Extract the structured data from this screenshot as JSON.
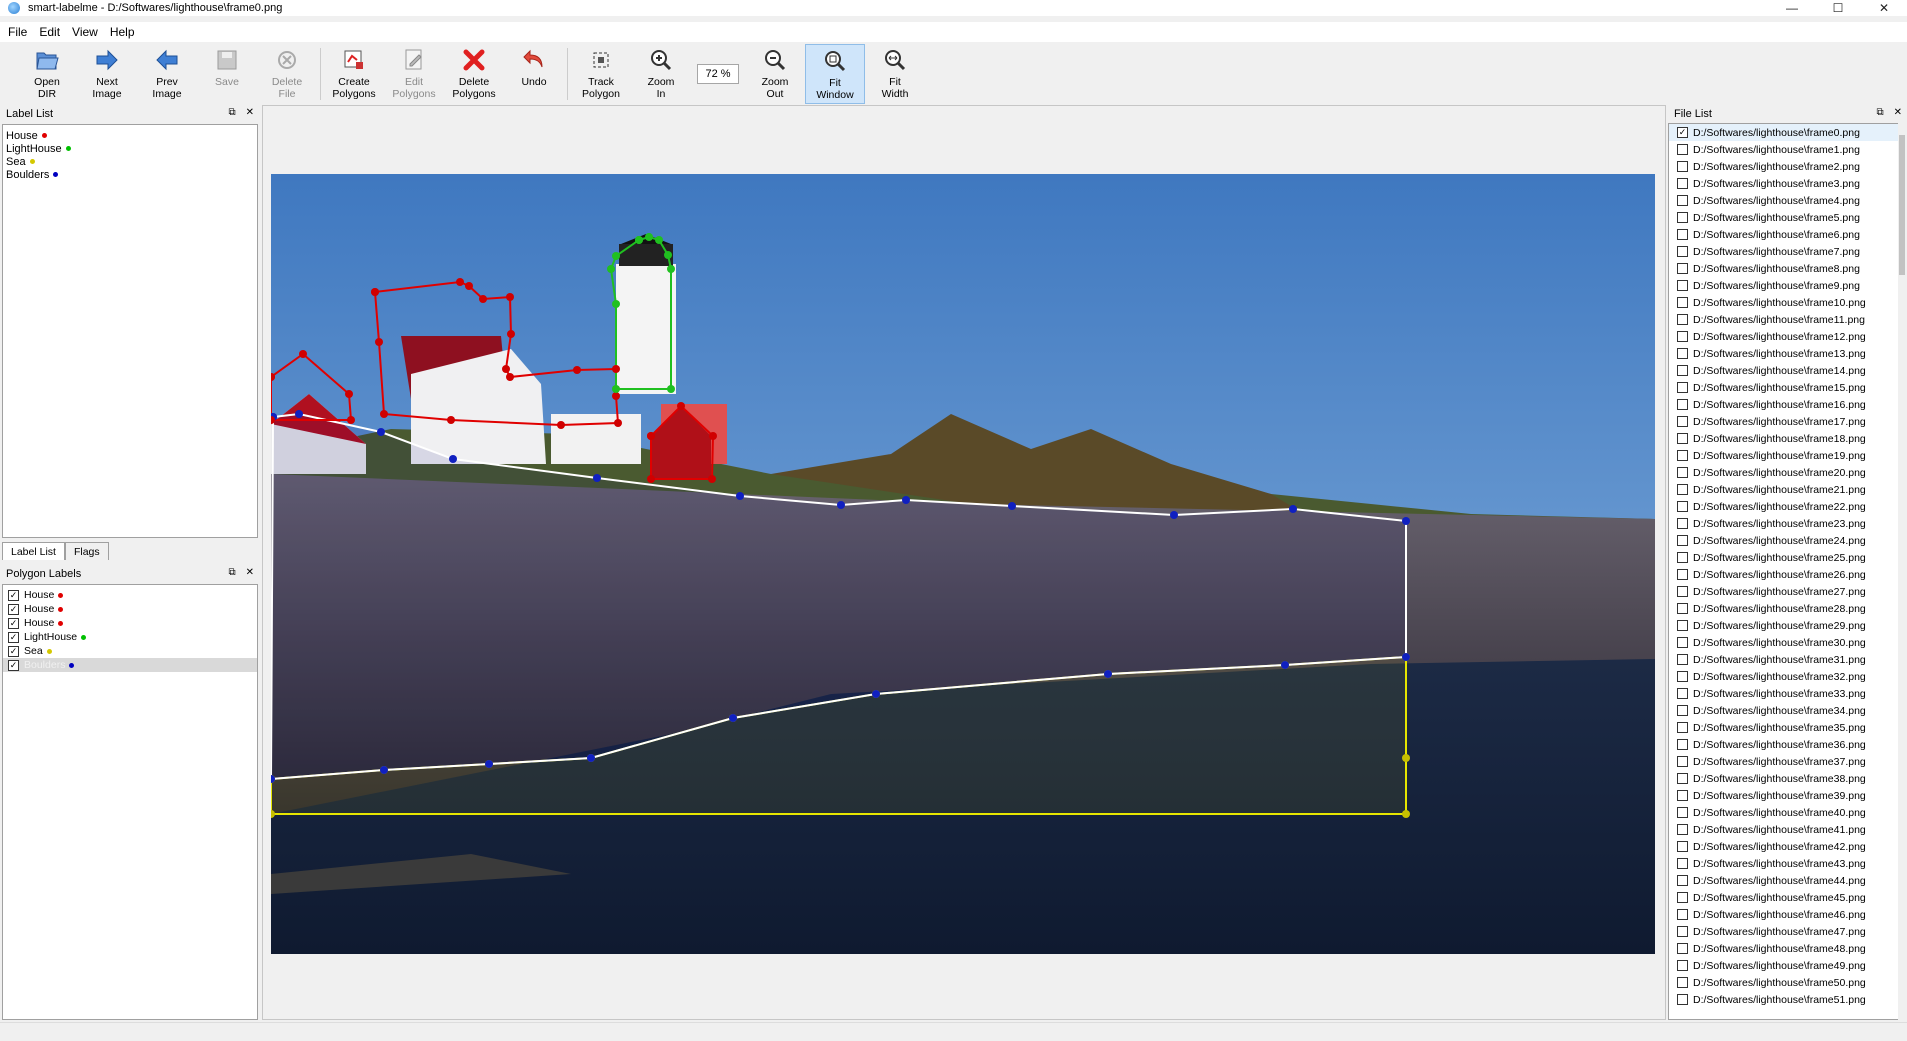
{
  "window": {
    "title": "smart-labelme - D:/Softwares/lighthouse\\frame0.png",
    "minimize": "—",
    "maximize": "☐",
    "close": "✕"
  },
  "menu": [
    "File",
    "Edit",
    "View",
    "Help"
  ],
  "toolbar": {
    "open_dir": [
      "Open",
      "DIR"
    ],
    "next_image": [
      "Next",
      "Image"
    ],
    "prev_image": [
      "Prev",
      "Image"
    ],
    "save": [
      "Save"
    ],
    "delete_file": [
      "Delete",
      "File"
    ],
    "create_polygons": [
      "Create",
      "Polygons"
    ],
    "edit_polygons": [
      "Edit",
      "Polygons"
    ],
    "delete_polygons": [
      "Delete",
      "Polygons"
    ],
    "undo": [
      "Undo"
    ],
    "track_polygon": [
      "Track",
      "Polygon"
    ],
    "zoom_in": [
      "Zoom",
      "In"
    ],
    "zoom_value": "72 %",
    "zoom_out": [
      "Zoom",
      "Out"
    ],
    "fit_window": [
      "Fit",
      "Window"
    ],
    "fit_width": [
      "Fit",
      "Width"
    ]
  },
  "label_list": {
    "title": "Label List",
    "items": [
      {
        "label": "House",
        "color": "#e00000"
      },
      {
        "label": "LightHouse",
        "color": "#00c000"
      },
      {
        "label": "Sea",
        "color": "#d4c800"
      },
      {
        "label": "Boulders",
        "color": "#0000c0"
      }
    ]
  },
  "tabs": [
    "Label List",
    "Flags"
  ],
  "polygon_labels": {
    "title": "Polygon Labels",
    "items": [
      {
        "label": "House",
        "color": "#e00000",
        "checked": true
      },
      {
        "label": "House",
        "color": "#e00000",
        "checked": true
      },
      {
        "label": "House",
        "color": "#e00000",
        "checked": true
      },
      {
        "label": "LightHouse",
        "color": "#00c000",
        "checked": true
      },
      {
        "label": "Sea",
        "color": "#d4c800",
        "checked": true
      },
      {
        "label": "Boulders",
        "color": "#0000c0",
        "checked": true
      }
    ]
  },
  "file_list": {
    "title": "File List",
    "items": [
      "D:/Softwares/lighthouse\\frame0.png",
      "D:/Softwares/lighthouse\\frame1.png",
      "D:/Softwares/lighthouse\\frame2.png",
      "D:/Softwares/lighthouse\\frame3.png",
      "D:/Softwares/lighthouse\\frame4.png",
      "D:/Softwares/lighthouse\\frame5.png",
      "D:/Softwares/lighthouse\\frame6.png",
      "D:/Softwares/lighthouse\\frame7.png",
      "D:/Softwares/lighthouse\\frame8.png",
      "D:/Softwares/lighthouse\\frame9.png",
      "D:/Softwares/lighthouse\\frame10.png",
      "D:/Softwares/lighthouse\\frame11.png",
      "D:/Softwares/lighthouse\\frame12.png",
      "D:/Softwares/lighthouse\\frame13.png",
      "D:/Softwares/lighthouse\\frame14.png",
      "D:/Softwares/lighthouse\\frame15.png",
      "D:/Softwares/lighthouse\\frame16.png",
      "D:/Softwares/lighthouse\\frame17.png",
      "D:/Softwares/lighthouse\\frame18.png",
      "D:/Softwares/lighthouse\\frame19.png",
      "D:/Softwares/lighthouse\\frame20.png",
      "D:/Softwares/lighthouse\\frame21.png",
      "D:/Softwares/lighthouse\\frame22.png",
      "D:/Softwares/lighthouse\\frame23.png",
      "D:/Softwares/lighthouse\\frame24.png",
      "D:/Softwares/lighthouse\\frame25.png",
      "D:/Softwares/lighthouse\\frame26.png",
      "D:/Softwares/lighthouse\\frame27.png",
      "D:/Softwares/lighthouse\\frame28.png",
      "D:/Softwares/lighthouse\\frame29.png",
      "D:/Softwares/lighthouse\\frame30.png",
      "D:/Softwares/lighthouse\\frame31.png",
      "D:/Softwares/lighthouse\\frame32.png",
      "D:/Softwares/lighthouse\\frame33.png",
      "D:/Softwares/lighthouse\\frame34.png",
      "D:/Softwares/lighthouse\\frame35.png",
      "D:/Softwares/lighthouse\\frame36.png",
      "D:/Softwares/lighthouse\\frame37.png",
      "D:/Softwares/lighthouse\\frame38.png",
      "D:/Softwares/lighthouse\\frame39.png",
      "D:/Softwares/lighthouse\\frame40.png",
      "D:/Softwares/lighthouse\\frame41.png",
      "D:/Softwares/lighthouse\\frame42.png",
      "D:/Softwares/lighthouse\\frame43.png",
      "D:/Softwares/lighthouse\\frame44.png",
      "D:/Softwares/lighthouse\\frame45.png",
      "D:/Softwares/lighthouse\\frame46.png",
      "D:/Softwares/lighthouse\\frame47.png",
      "D:/Softwares/lighthouse\\frame48.png",
      "D:/Softwares/lighthouse\\frame49.png",
      "D:/Softwares/lighthouse\\frame50.png",
      "D:/Softwares/lighthouse\\frame51.png"
    ],
    "selected_index": 0
  },
  "dock_buttons": {
    "float": "⧉",
    "close": "✕"
  }
}
